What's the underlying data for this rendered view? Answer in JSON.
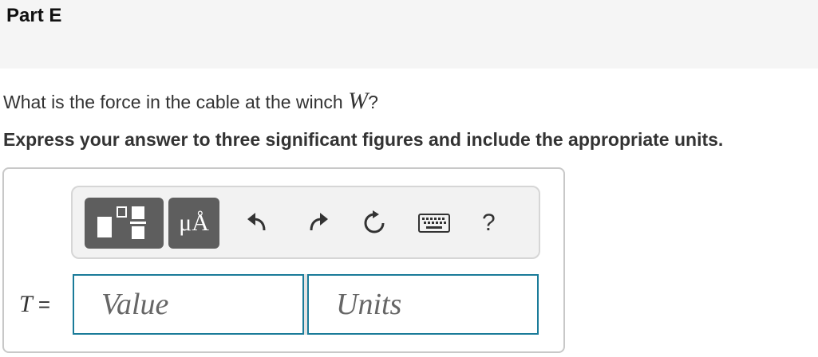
{
  "part": {
    "title": "Part E"
  },
  "question": {
    "text": "What is the force in the cable at the winch ",
    "variable": "W",
    "suffix": "?"
  },
  "instruction": {
    "text": "Express your answer to three significant figures and include the appropriate units."
  },
  "toolbar": {
    "templates_icon": "fraction-template-icon",
    "units_label": "μÅ",
    "undo_icon": "undo-icon",
    "redo_icon": "redo-icon",
    "reset_icon": "reset-icon",
    "keyboard_icon": "keyboard-icon",
    "help_label": "?"
  },
  "answer": {
    "variable": "T",
    "equals": "=",
    "value_placeholder": "Value",
    "units_placeholder": "Units"
  },
  "colors": {
    "input_border": "#1a7b99",
    "toolbar_button": "#5e5e5e",
    "header_bg": "#f5f5f5"
  }
}
